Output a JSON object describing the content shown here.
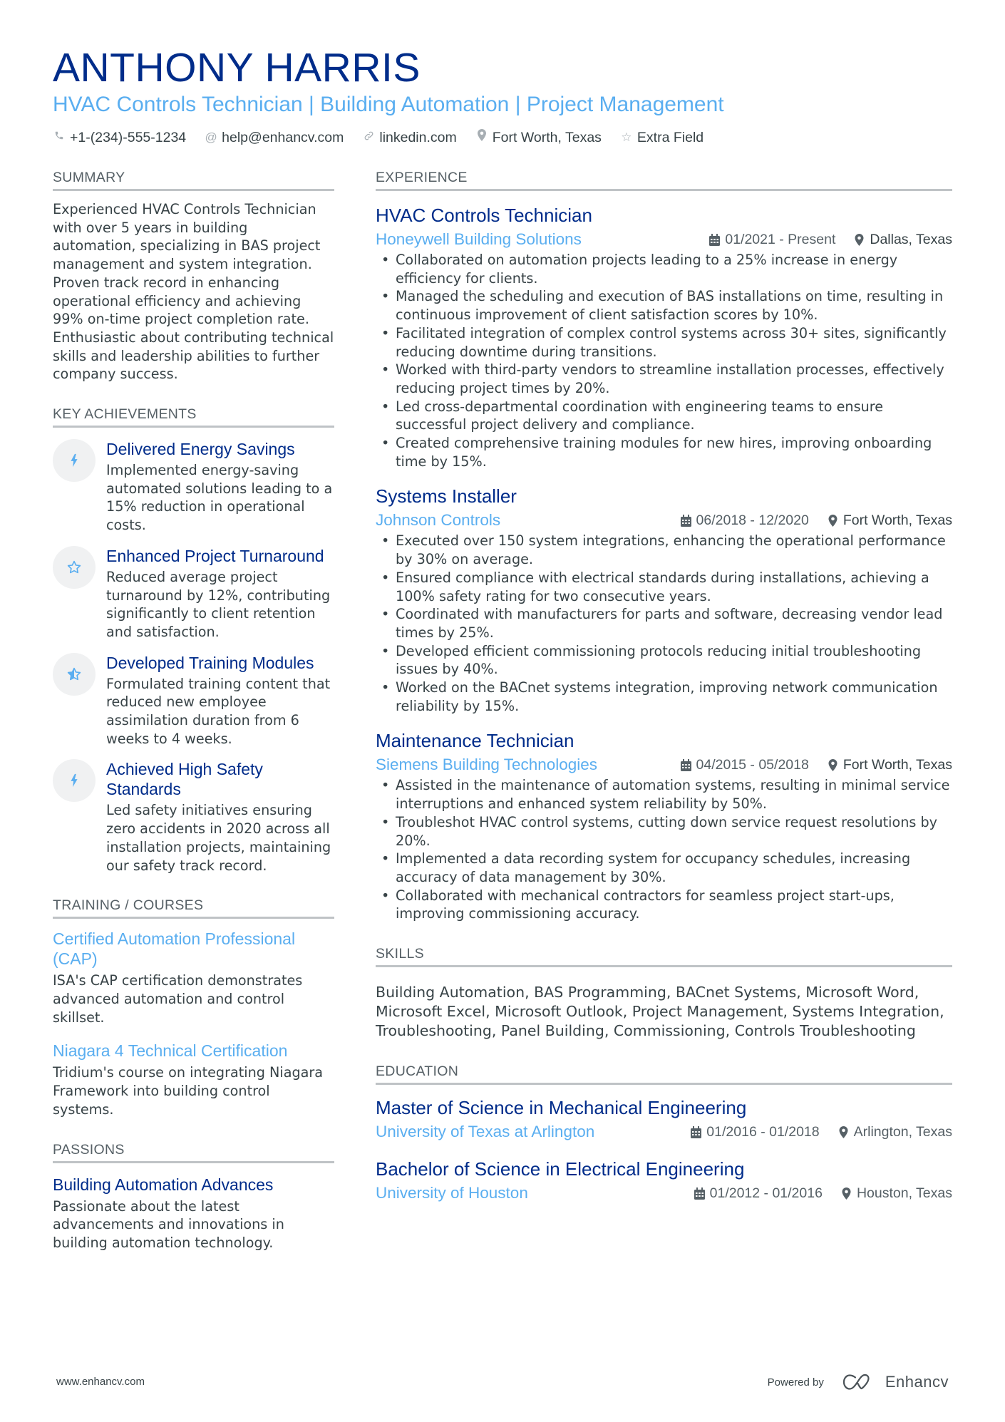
{
  "header": {
    "name": "ANTHONY HARRIS",
    "headline": "HVAC Controls Technician | Building Automation | Project Management",
    "contacts": [
      {
        "icon": "phone-icon",
        "text": "+1-(234)-555-1234"
      },
      {
        "icon": "at-icon",
        "text": "help@enhancv.com"
      },
      {
        "icon": "link-icon",
        "text": "linkedin.com"
      },
      {
        "icon": "location-pin-icon",
        "text": "Fort Worth, Texas"
      },
      {
        "icon": "star-icon",
        "text": "Extra Field"
      }
    ]
  },
  "summary": {
    "title": "SUMMARY",
    "text": "Experienced HVAC Controls Technician with over 5 years in building automation, specializing in BAS project management and system integration. Proven track record in enhancing operational efficiency and achieving 99% on-time project completion rate. Enthusiastic about contributing technical skills and leadership abilities to further company success."
  },
  "achievements": {
    "title": "KEY ACHIEVEMENTS",
    "items": [
      {
        "icon": "lightning-bolt-icon",
        "title": "Delivered Energy Savings",
        "description": "Implemented energy-saving automated solutions leading to a 15% reduction in operational costs."
      },
      {
        "icon": "star-outline-icon",
        "title": "Enhanced Project Turnaround",
        "description": "Reduced average project turnaround by 12%, contributing significantly to client retention and satisfaction."
      },
      {
        "icon": "star-half-icon",
        "title": "Developed Training Modules",
        "description": "Formulated training content that reduced new employee assimilation duration from 6 weeks to 4 weeks."
      },
      {
        "icon": "lightning-bolt-icon",
        "title": "Achieved High Safety Standards",
        "description": "Led safety initiatives ensuring zero accidents in 2020 across all installation projects, maintaining our safety track record."
      }
    ]
  },
  "training": {
    "title": "TRAINING / COURSES",
    "items": [
      {
        "title": "Certified Automation Professional (CAP)",
        "description": "ISA's CAP certification demonstrates advanced automation and control skillset."
      },
      {
        "title": "Niagara 4 Technical Certification",
        "description": "Tridium's course on integrating Niagara Framework into building control systems."
      }
    ]
  },
  "passions": {
    "title": "PASSIONS",
    "items": [
      {
        "title": "Building Automation Advances",
        "description": "Passionate about the latest advancements and innovations in building automation technology."
      }
    ]
  },
  "experience": {
    "title": "EXPERIENCE",
    "jobs": [
      {
        "title": "HVAC Controls Technician",
        "company": "Honeywell Building Solutions",
        "dates": "01/2021 - Present",
        "location": "Dallas, Texas",
        "bullets": [
          "Collaborated on automation projects leading to a 25% increase in energy efficiency for clients.",
          "Managed the scheduling and execution of BAS installations on time, resulting in continuous improvement of client satisfaction scores by 10%.",
          "Facilitated integration of complex control systems across 30+ sites, significantly reducing downtime during transitions.",
          "Worked with third-party vendors to streamline installation processes, effectively reducing project times by 20%.",
          "Led cross-departmental coordination with engineering teams to ensure successful project delivery and compliance.",
          "Created comprehensive training modules for new hires, improving onboarding time by 15%."
        ]
      },
      {
        "title": "Systems Installer",
        "company": "Johnson Controls",
        "dates": "06/2018 - 12/2020",
        "location": "Fort Worth, Texas",
        "bullets": [
          "Executed over 150 system integrations, enhancing the operational performance by 30% on average.",
          "Ensured compliance with electrical standards during installations, achieving a 100% safety rating for two consecutive years.",
          "Coordinated with manufacturers for parts and software, decreasing vendor lead times by 25%.",
          "Developed efficient commissioning protocols reducing initial troubleshooting issues by 40%.",
          "Worked on the BACnet systems integration, improving network communication reliability by 15%."
        ]
      },
      {
        "title": "Maintenance Technician",
        "company": "Siemens Building Technologies",
        "dates": "04/2015 - 05/2018",
        "location": "Fort Worth, Texas",
        "bullets": [
          "Assisted in the maintenance of automation systems, resulting in minimal service interruptions and enhanced system reliability by 50%.",
          "Troubleshot HVAC control systems, cutting down service request resolutions by 20%.",
          "Implemented a data recording system for occupancy schedules, increasing accuracy of data management by 30%.",
          "Collaborated with mechanical contractors for seamless project start-ups, improving commissioning accuracy."
        ]
      }
    ]
  },
  "skills": {
    "title": "SKILLS",
    "text": "Building Automation, BAS Programming, BACnet Systems, Microsoft Word, Microsoft Excel, Microsoft Outlook, Project Management, Systems Integration, Troubleshooting, Panel Building, Commissioning, Controls Troubleshooting"
  },
  "education": {
    "title": "EDUCATION",
    "items": [
      {
        "degree": "Master of Science in Mechanical Engineering",
        "school": "University of Texas at Arlington",
        "dates": "01/2016 - 01/2018",
        "location": "Arlington, Texas"
      },
      {
        "degree": "Bachelor of Science in Electrical Engineering",
        "school": "University of Houston",
        "dates": "01/2012 - 01/2016",
        "location": "Houston, Texas"
      }
    ]
  },
  "footer": {
    "website": "www.enhancv.com",
    "powered_by": "Powered by",
    "brand": "Enhancv"
  },
  "colors": {
    "name": "#002c8a",
    "accent": "#5aaef0",
    "text": "#384347",
    "muted": "#566066",
    "rule": "#bfc3c6",
    "icon_bg": "#f0f1f2"
  }
}
